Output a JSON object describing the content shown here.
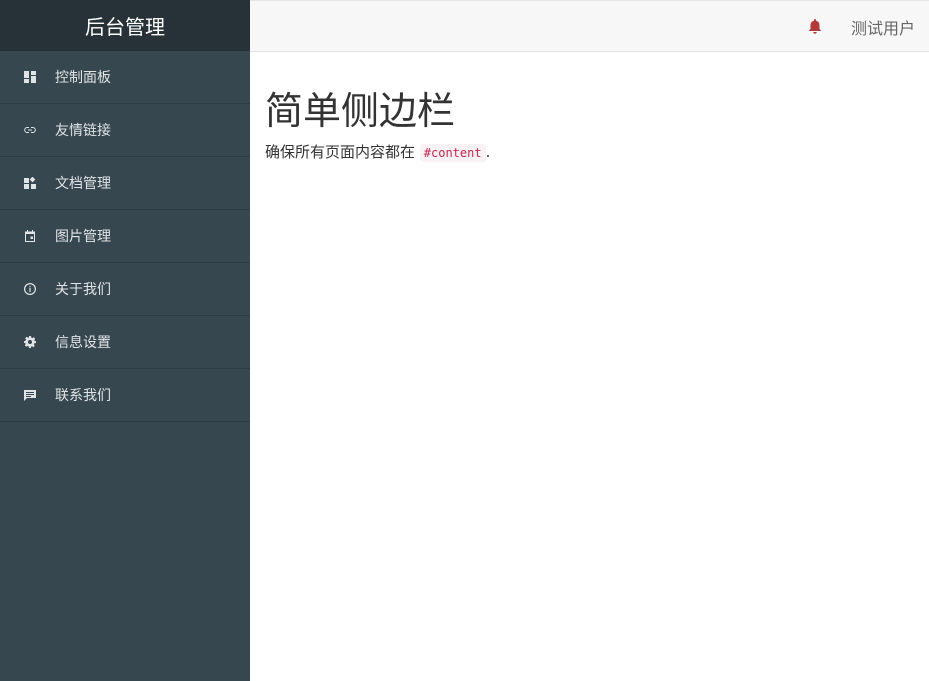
{
  "sidebar": {
    "brand": "后台管理",
    "items": [
      {
        "label": "控制面板",
        "icon": "dashboard-icon"
      },
      {
        "label": "友情链接",
        "icon": "link-icon"
      },
      {
        "label": "文档管理",
        "icon": "document-icon"
      },
      {
        "label": "图片管理",
        "icon": "calendar-icon"
      },
      {
        "label": "关于我们",
        "icon": "info-icon"
      },
      {
        "label": "信息设置",
        "icon": "gear-icon"
      },
      {
        "label": "联系我们",
        "icon": "chat-icon"
      }
    ]
  },
  "topbar": {
    "bell_icon": "bell-icon",
    "bell_color": "#b33a3a",
    "username": "测试用户"
  },
  "content": {
    "title": "简单侧边栏",
    "text_before": "确保所有页面内容都在 ",
    "code": "#content",
    "text_after": "."
  },
  "colors": {
    "sidebar_bg": "#37474f",
    "brand_bg": "#263238",
    "topbar_bg": "#f7f7f7",
    "code_color": "#c7254e"
  }
}
